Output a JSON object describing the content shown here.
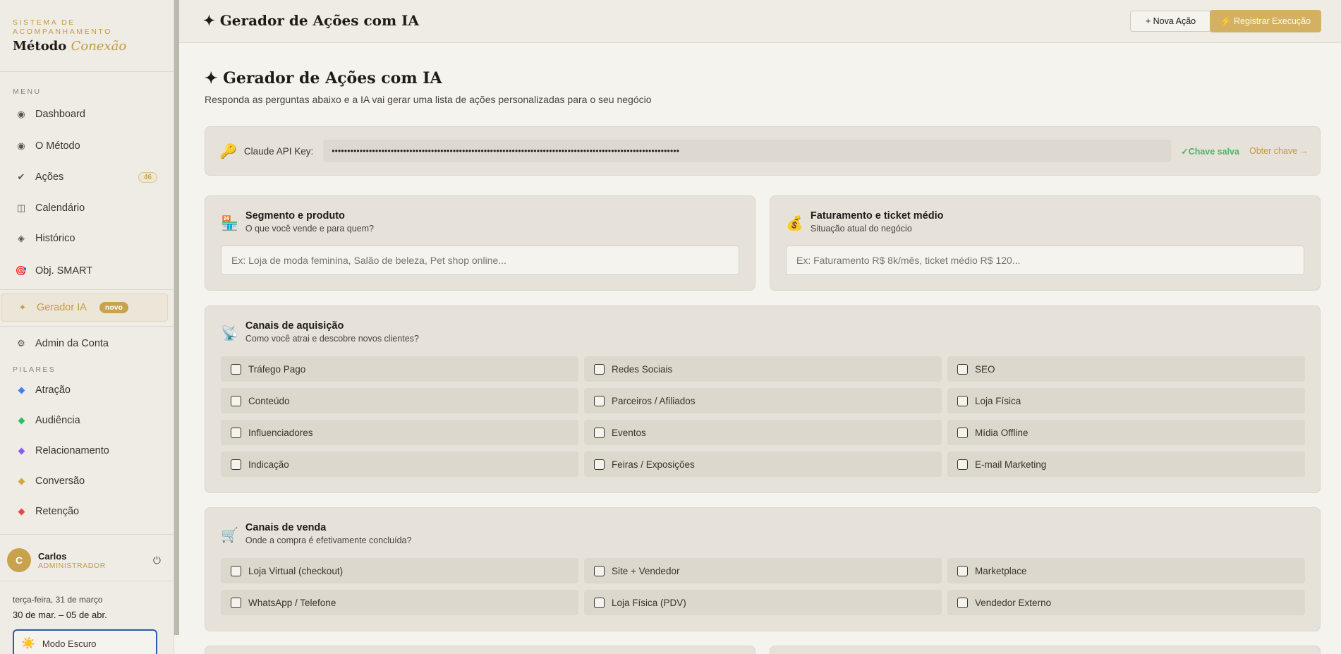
{
  "sidebar": {
    "brand_sub": "SISTEMA DE ACOMPANHAMENTO",
    "brand_name": "Método",
    "brand_name_accent": "Conexão",
    "menu_label": "MENU",
    "items": [
      {
        "label": "Dashboard",
        "icon": "◉"
      },
      {
        "label": "O Método",
        "icon": "◉"
      },
      {
        "label": "Ações",
        "icon": "✔",
        "badge": "46"
      },
      {
        "label": "Calendário",
        "icon": "◫"
      },
      {
        "label": "Histórico",
        "icon": "◈"
      },
      {
        "label": "Obj. SMART",
        "icon": "🎯"
      },
      {
        "label": "Gerador IA",
        "icon": "✦",
        "badge": "novo"
      },
      {
        "label": "Admin da Conta",
        "icon": "⚙"
      }
    ],
    "pillars_label": "PILARES",
    "pillars": [
      {
        "label": "Atração",
        "color": "#3b82f6"
      },
      {
        "label": "Audiência",
        "color": "#22c55e"
      },
      {
        "label": "Relacionamento",
        "color": "#8b5cf6"
      },
      {
        "label": "Conversão",
        "color": "#d4a73a"
      },
      {
        "label": "Retenção",
        "color": "#ef4444"
      }
    ],
    "user": {
      "initial": "C",
      "name": "Carlos",
      "role": "ADMINISTRADOR"
    },
    "date_small": "terça-feira, 31 de março",
    "date_range": "30 de mar. – 05 de abr.",
    "dark_mode": "Modo Escuro"
  },
  "topbar": {
    "title": "✦ Gerador de Ações com IA",
    "new_action": "+ Nova Ação",
    "register": "⚡ Registrar Execução"
  },
  "main": {
    "title": "✦ Gerador de Ações com IA",
    "subtitle": "Responda as perguntas abaixo e a IA vai gerar uma lista de ações personalizadas para o seu negócio",
    "api": {
      "label": "Claude API Key:",
      "value": "••••••••••••••••••••••••••••••••••••••••••••••••••••••••••••••••••••••••••••••••••••••••••••••••••••••••••••••••",
      "saved": "✓Chave salva",
      "link": "Obter chave →"
    },
    "segment": {
      "title": "Segmento e produto",
      "subtitle": "O que você vende e para quem?",
      "placeholder": "Ex: Loja de moda feminina, Salão de beleza, Pet shop online..."
    },
    "revenue": {
      "title": "Faturamento e ticket médio",
      "subtitle": "Situação atual do negócio",
      "placeholder": "Ex: Faturamento R$ 8k/mês, ticket médio R$ 120..."
    },
    "acquisition": {
      "title": "Canais de aquisição",
      "subtitle": "Como você atrai e descobre novos clientes?",
      "options": [
        "Tráfego Pago",
        "Redes Sociais",
        "SEO",
        "Conteúdo",
        "Parceiros / Afiliados",
        "Loja Física",
        "Influenciadores",
        "Eventos",
        "Mídia Offline",
        "Indicação",
        "Feiras / Exposições",
        "E-mail Marketing"
      ]
    },
    "sales": {
      "title": "Canais de venda",
      "subtitle": "Onde a compra é efetivamente concluída?",
      "options": [
        "Loja Virtual (checkout)",
        "Site + Vendedor",
        "Marketplace",
        "WhatsApp / Telefone",
        "Loja Física (PDV)",
        "Vendedor Externo"
      ]
    }
  }
}
